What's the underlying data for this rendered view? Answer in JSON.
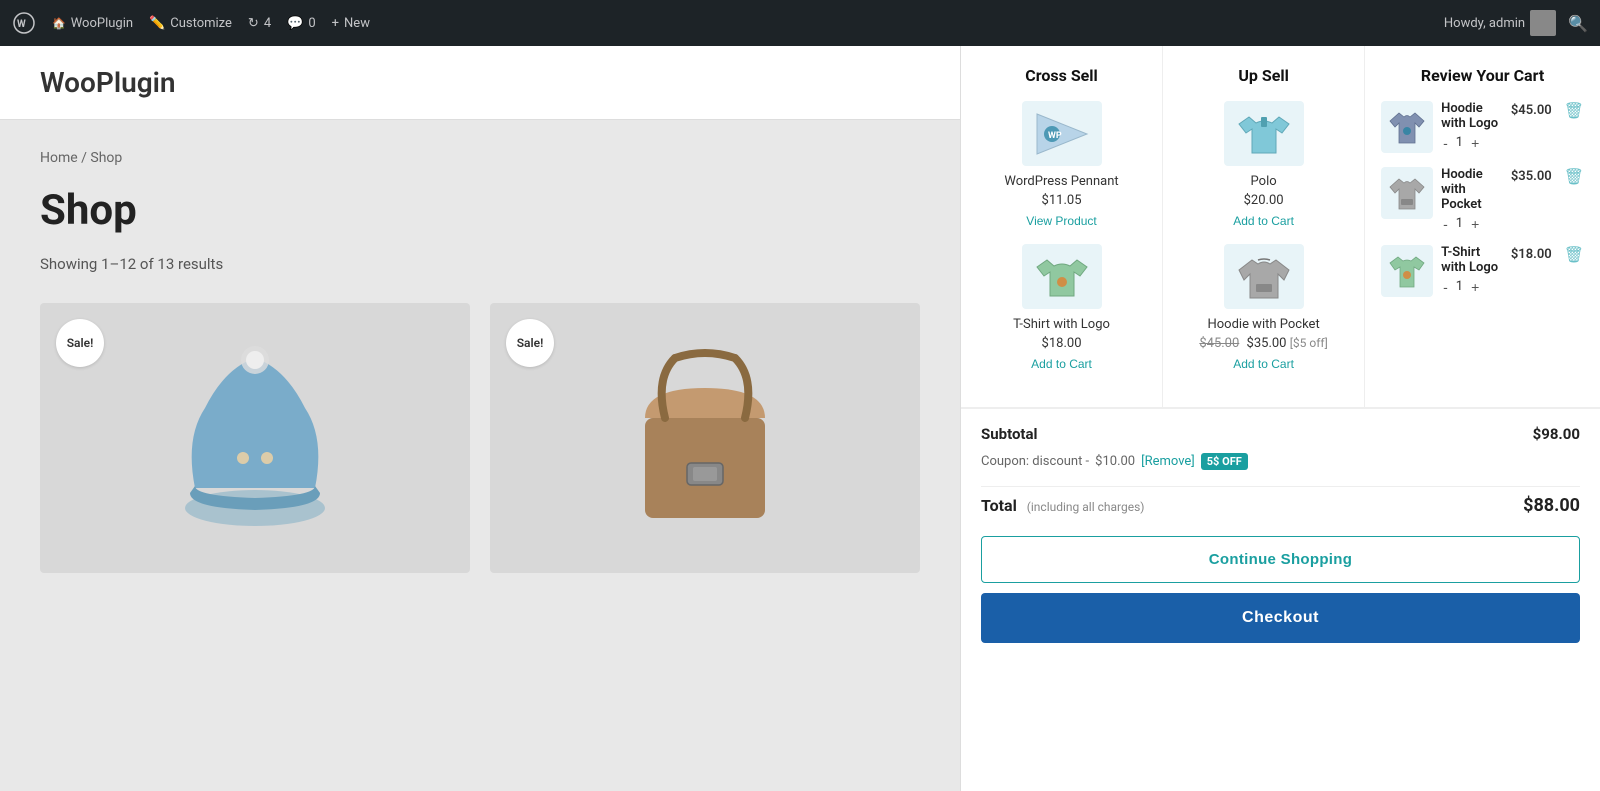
{
  "adminBar": {
    "siteName": "WooPlugin",
    "customize": "Customize",
    "updates": "4",
    "comments": "0",
    "new": "New",
    "howdy": "Howdy, admin"
  },
  "shop": {
    "siteTitle": "WooPlugin",
    "breadcrumb": "Home / Shop",
    "pageTitle": "Shop",
    "resultsCount": "Showing 1–12 of 13 results",
    "products": [
      {
        "badge": "Sale!",
        "name": "Beanie"
      },
      {
        "badge": "Sale!",
        "name": "Bag"
      }
    ]
  },
  "cart": {
    "reviewTitle": "Review Your Cart",
    "crossSellTitle": "Cross Sell",
    "upSellTitle": "Up Sell",
    "crossSellProducts": [
      {
        "name": "WordPress Pennant",
        "price": "$11.05",
        "action": "View Product"
      },
      {
        "name": "T-Shirt with Logo",
        "price": "$18.00",
        "action": "Add to Cart"
      }
    ],
    "upSellProducts": [
      {
        "name": "Polo",
        "price": "$20.00",
        "action": "Add to Cart"
      },
      {
        "name": "Hoodie with Pocket",
        "priceOriginal": "$45.00",
        "priceSale": "$35.00",
        "discount": "[$5 off]",
        "action": "Add to Cart"
      }
    ],
    "cartItems": [
      {
        "name": "Hoodie with Logo",
        "qty": "1",
        "price": "$45.00"
      },
      {
        "name": "Hoodie with Pocket",
        "qty": "1",
        "price": "$35.00"
      },
      {
        "name": "T-Shirt with Logo",
        "qty": "1",
        "price": "$18.00"
      }
    ],
    "subtotalLabel": "Subtotal",
    "subtotalValue": "$98.00",
    "couponText": "Coupon: discount -",
    "couponAmount": "$10.00",
    "couponRemove": "[Remove]",
    "couponBadge": "5$ OFF",
    "totalLabel": "Total",
    "totalNote": "(including all charges)",
    "totalValue": "$88.00",
    "continueShoppingLabel": "Continue Shopping",
    "checkoutLabel": "Checkout"
  }
}
